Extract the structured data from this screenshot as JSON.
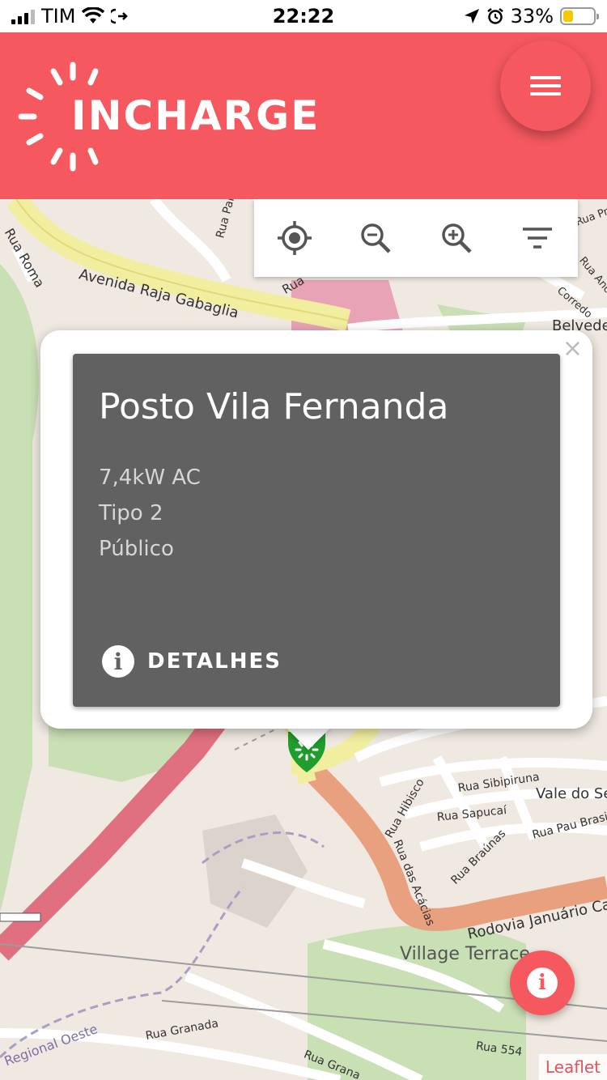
{
  "status_bar": {
    "carrier": "TIM",
    "time": "22:22",
    "battery_percent": "33%",
    "battery_level": 0.33,
    "icons": [
      "signal-icon",
      "wifi-icon",
      "call-forward-icon",
      "location-arrow-icon",
      "alarm-icon",
      "battery-icon"
    ]
  },
  "header": {
    "logo_text": "INCHARGE",
    "menu_icon": "hamburger-menu-icon",
    "background_color": "#f5585f"
  },
  "map_toolbar": {
    "tools": [
      {
        "name": "locate",
        "icon": "crosshair-icon"
      },
      {
        "name": "zoom-out",
        "icon": "zoom-out-icon"
      },
      {
        "name": "zoom-in",
        "icon": "zoom-in-icon"
      },
      {
        "name": "filter",
        "icon": "filter-icon"
      }
    ]
  },
  "map": {
    "labels": [
      "Rua Roma",
      "Avenida Raja Gabaglia",
      "Rua Parentins",
      "Rua",
      "Belvede",
      "Rua Hibisco",
      "Rua Sibipiruna",
      "Vale do Se",
      "Rua Sapucaí",
      "Rua Pau Brasi",
      "Rua das Acácias",
      "Rua Braúnas",
      "Rodovia Januário Ca",
      "Village Terrace",
      "Regional Oeste",
      "Rua Granada",
      "Rua Grana",
      "Rua 554",
      "Rua Pro",
      "Rua Anc",
      "Corredo"
    ],
    "marker_icon": "charging-station-marker-icon",
    "marker_color": "#1f9e2e"
  },
  "popup": {
    "close_symbol": "×",
    "station_name": "Posto Vila Fernanda",
    "power": "7,4kW AC",
    "connector": "Tipo 2",
    "access": "Público",
    "details_label": "DETALHES",
    "details_icon": "info-icon"
  },
  "info_fab": {
    "icon": "info-icon",
    "symbol": "i"
  },
  "attribution": "Leaflet"
}
